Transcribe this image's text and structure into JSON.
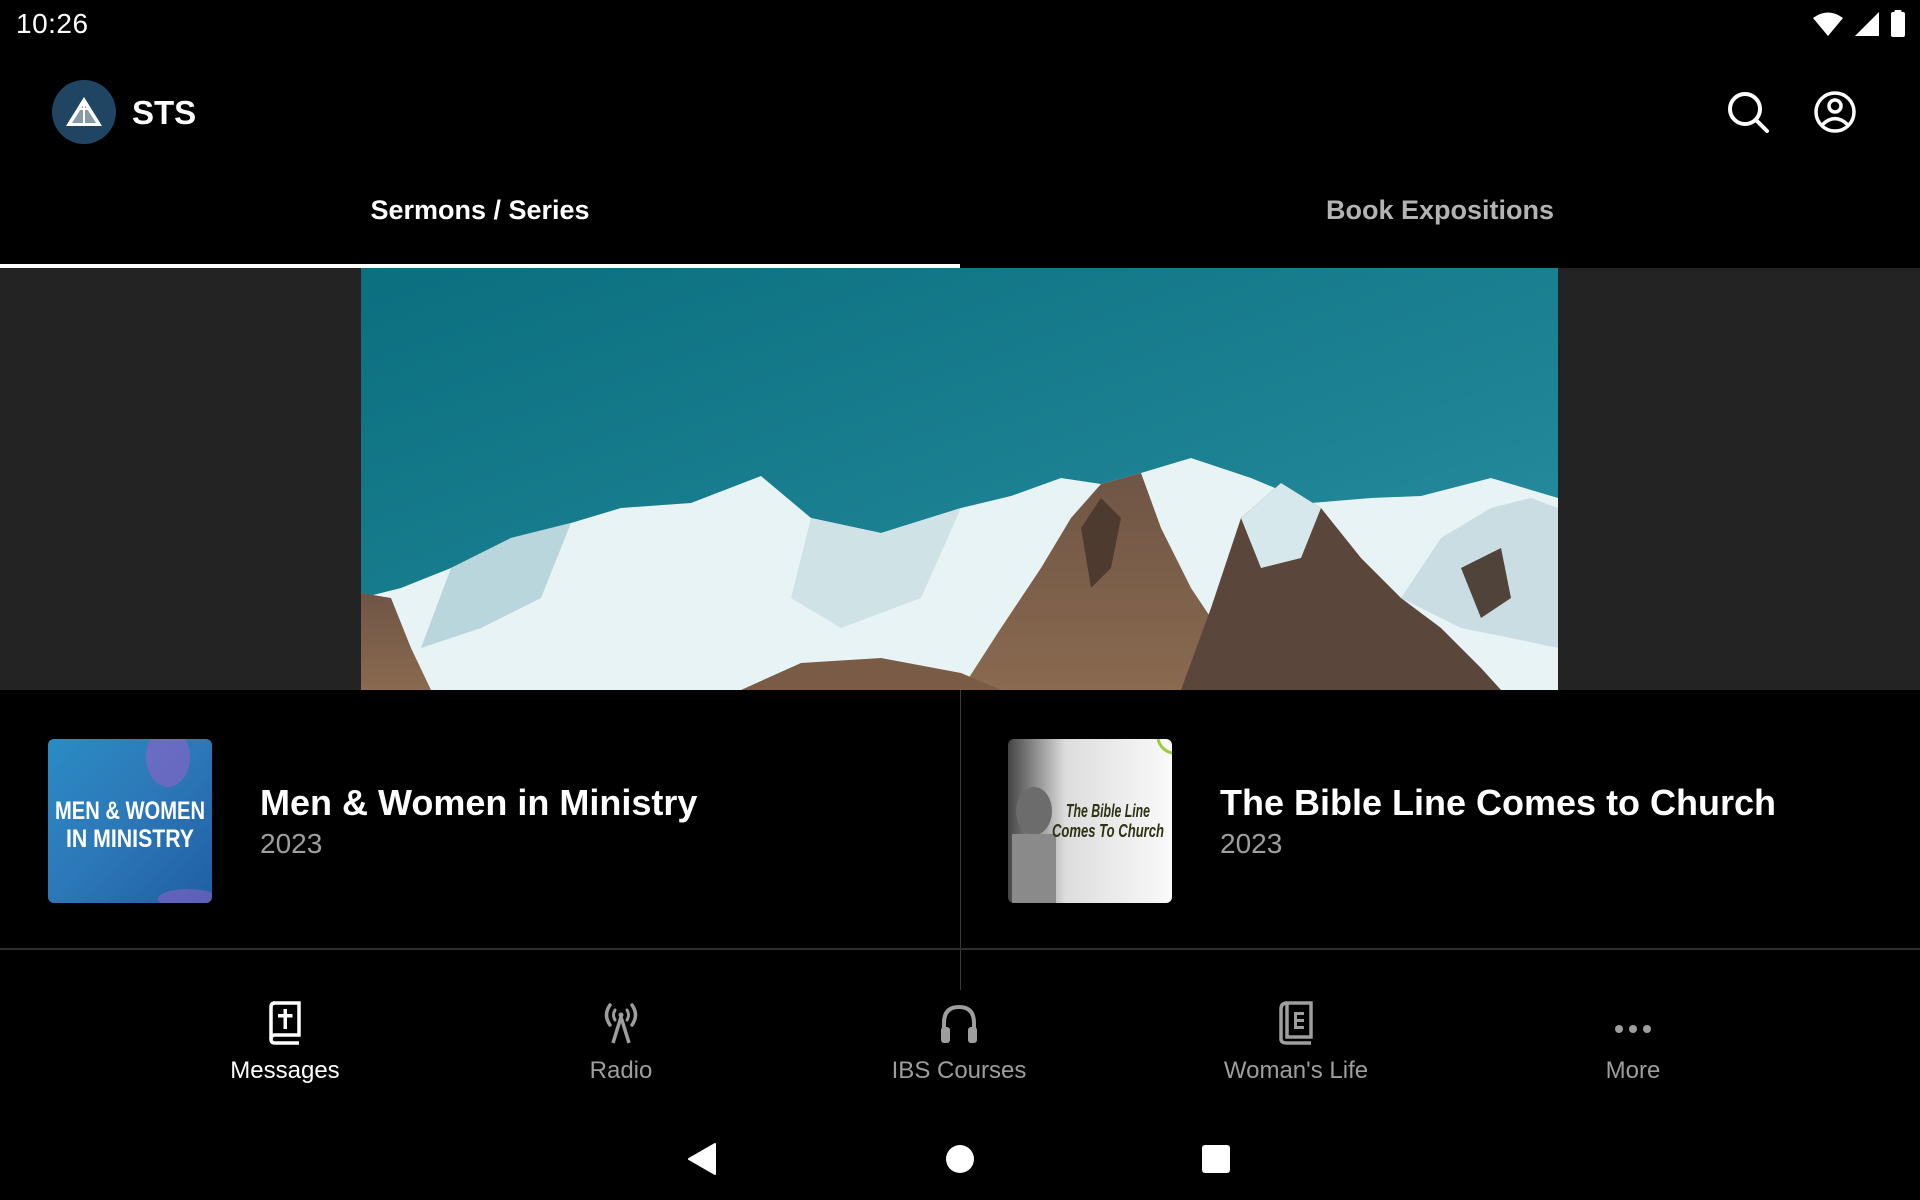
{
  "status_bar": {
    "time": "10:26",
    "icons": [
      "wifi-icon",
      "cellular-signal-icon",
      "battery-icon"
    ]
  },
  "app_bar": {
    "logo_text": "STS",
    "title": "STS",
    "actions": [
      {
        "name": "search",
        "icon": "search-icon"
      },
      {
        "name": "account",
        "icon": "account-circle-icon"
      }
    ]
  },
  "tabs": [
    {
      "label": "Sermons / Series",
      "active": true
    },
    {
      "label": "Book Expositions",
      "active": false
    }
  ],
  "banner": {
    "description": "Snow-capped mountain range under teal sky"
  },
  "series": [
    {
      "title": "Men & Women in Ministry",
      "year": "2023",
      "thumbnail_text": [
        "MEN & WOMEN",
        "IN MINISTRY"
      ]
    },
    {
      "title": "The Bible Line Comes to Church",
      "year": "2023",
      "thumbnail_text": [
        "The Bible Line",
        "Comes To Church"
      ]
    }
  ],
  "bottom_nav": [
    {
      "label": "Messages",
      "icon": "bible-icon",
      "active": true
    },
    {
      "label": "Radio",
      "icon": "radio-tower-icon",
      "active": false
    },
    {
      "label": "IBS Courses",
      "icon": "headphones-icon",
      "active": false
    },
    {
      "label": "Woman's Life",
      "icon": "book-icon",
      "active": false
    },
    {
      "label": "More",
      "icon": "more-horiz-icon",
      "active": false
    }
  ],
  "system_nav": [
    "back",
    "home",
    "recents"
  ],
  "colors": {
    "background": "#000000",
    "banner_backdrop": "#232323",
    "logo_circle": "#1f4562",
    "active_text": "#ffffff",
    "inactive_text": "#9e9e9e",
    "sky": "#1d8293"
  }
}
